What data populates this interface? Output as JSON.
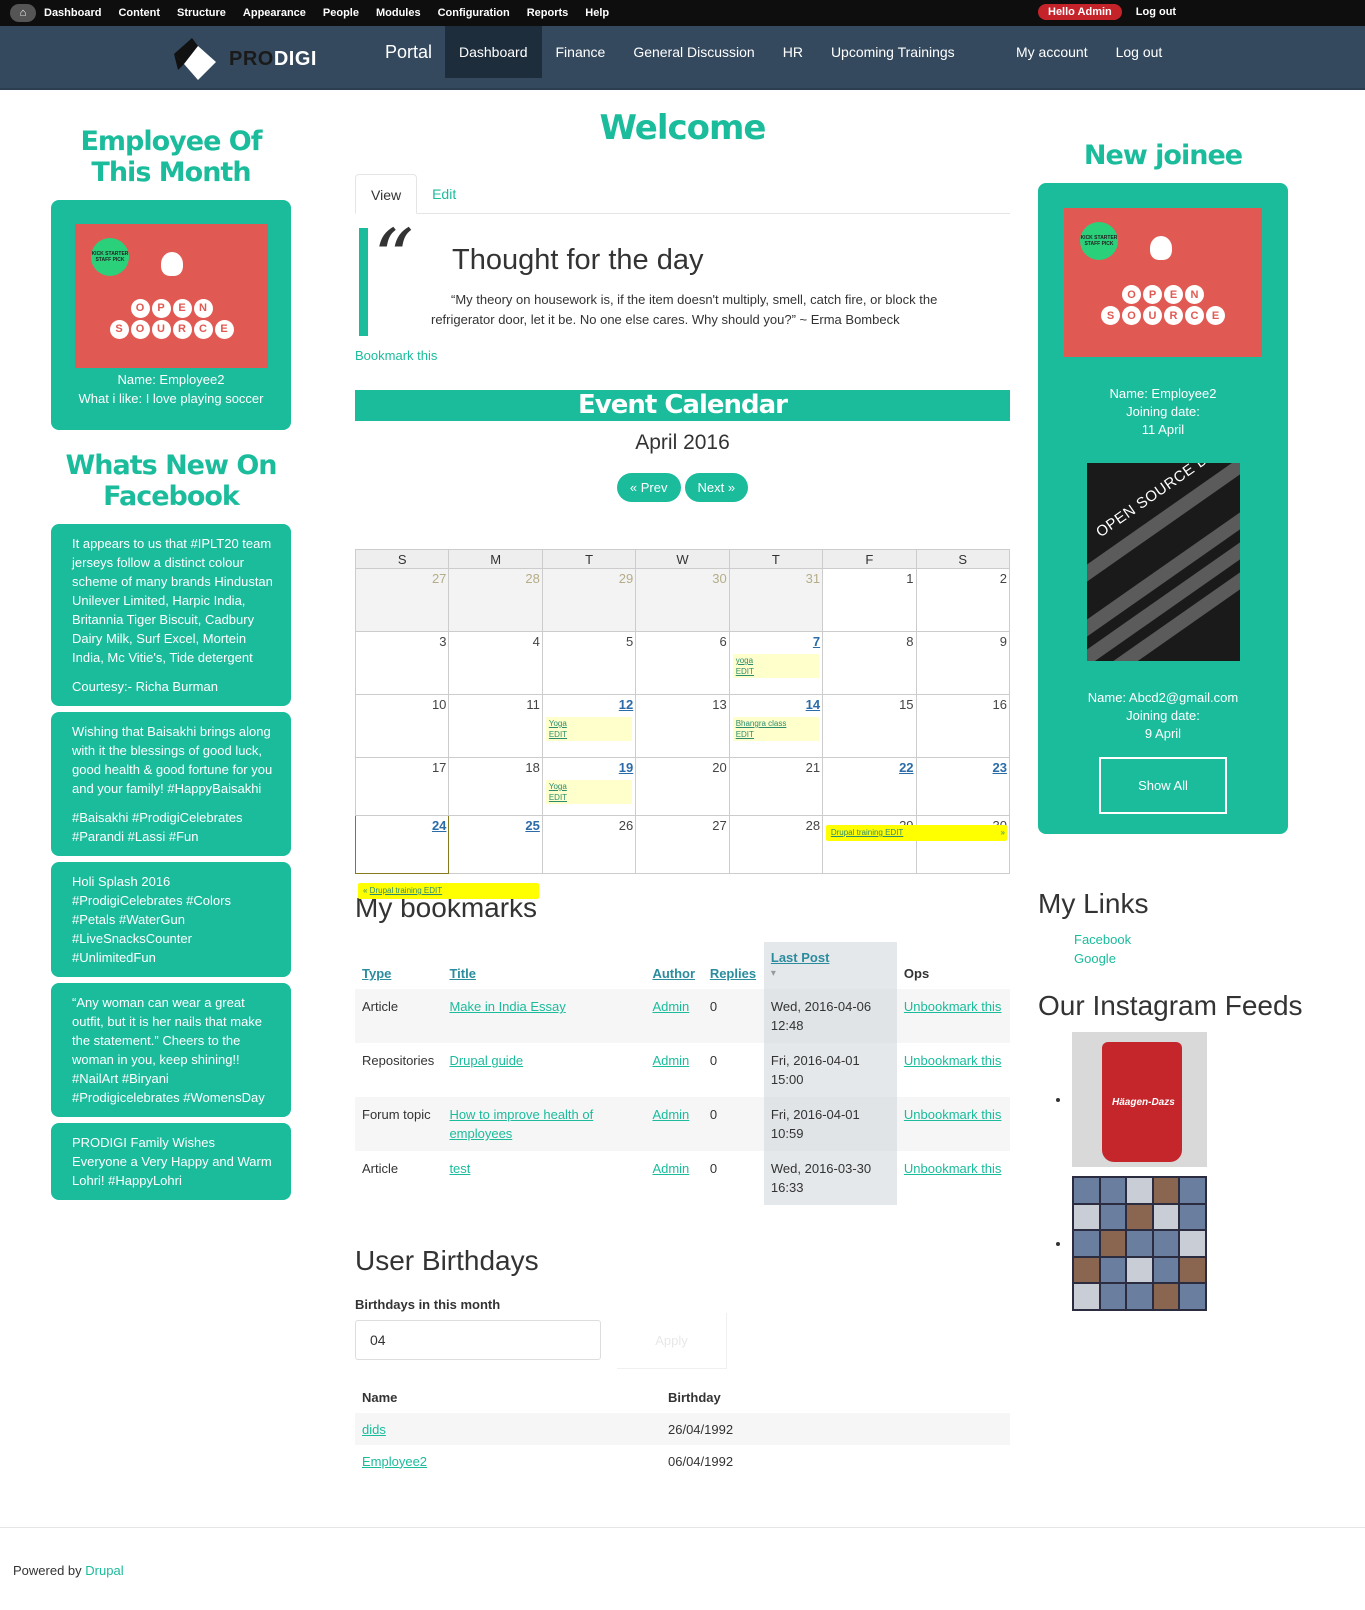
{
  "admin_bar": {
    "items": [
      "Dashboard",
      "Content",
      "Structure",
      "Appearance",
      "People",
      "Modules",
      "Configuration",
      "Reports",
      "Help"
    ],
    "hello": "Hello Admin",
    "logout": "Log out"
  },
  "navbar": {
    "logo_pro": "PRO",
    "logo_digi": "DIGI",
    "title": "Portal",
    "links": [
      "Dashboard",
      "Finance",
      "General Discussion",
      "HR",
      "Upcoming Trainings"
    ],
    "active": "Dashboard",
    "right_links": [
      "My account",
      "Log out"
    ]
  },
  "employee_month": {
    "title": "Employee Of This Month",
    "badge": "KICK STARTER STAFF PICK",
    "image_letters_top": [
      "O",
      "P",
      "E",
      "N"
    ],
    "image_letters_bottom": [
      "S",
      "O",
      "U",
      "R",
      "C",
      "E"
    ],
    "name": "Name: Employee2",
    "like": "What i like: I love playing soccer"
  },
  "facebook": {
    "title": "Whats New On Facebook",
    "posts": [
      [
        "It appears to us that #IPLT20 team jerseys follow a distinct colour scheme of many brands Hindustan Unilever Limited, Harpic India, Britannia Tiger Biscuit, Cadbury Dairy Milk, Surf Excel, Mortein India, Mc Vitie's, Tide detergent",
        "Courtesy:- Richa Burman"
      ],
      [
        "Wishing that Baisakhi brings along with it the blessings of good luck, good health & good fortune for you and your family! #HappyBaisakhi",
        "#Baisakhi #ProdigiCelebrates #Parandi #Lassi #Fun"
      ],
      [
        "Holi Splash 2016 #ProdigiCelebrates #Colors #Petals #WaterGun #LiveSnacksCounter #UnlimitedFun"
      ],
      [
        "“Any woman can wear a great outfit, but it is her nails that make the statement.” Cheers to the woman in you, keep shining!! #NailArt #Biryani #Prodigicelebrates #WomensDay"
      ],
      [
        "PRODIGI Family Wishes Everyone a Very Happy and Warm Lohri! #HappyLohri"
      ]
    ]
  },
  "center": {
    "welcome": "Welcome",
    "tabs": [
      "View",
      "Edit"
    ],
    "quote_mark": "“",
    "quote_title": "Thought for the day",
    "quote_text_1": "“My theory on housework is, if the item doesn't multiply, smell, catch fire, or block the",
    "quote_text_2": "refrigerator door, let it be. No one else cares. Why should you?” ~ Erma Bombeck",
    "bookmark_this": "Bookmark this"
  },
  "calendar": {
    "title": "Event Calendar",
    "month": "April 2016",
    "prev": "« Prev",
    "next": "Next »",
    "days": [
      "S",
      "M",
      "T",
      "W",
      "T",
      "F",
      "S"
    ],
    "weeks": [
      [
        {
          "d": "27",
          "o": true
        },
        {
          "d": "28",
          "o": true
        },
        {
          "d": "29",
          "o": true
        },
        {
          "d": "30",
          "o": true
        },
        {
          "d": "31",
          "o": true
        },
        {
          "d": "1"
        },
        {
          "d": "2"
        }
      ],
      [
        {
          "d": "3"
        },
        {
          "d": "4"
        },
        {
          "d": "5"
        },
        {
          "d": "6"
        },
        {
          "d": "7",
          "link": true,
          "ev": "yoga"
        },
        {
          "d": "8"
        },
        {
          "d": "9"
        }
      ],
      [
        {
          "d": "10"
        },
        {
          "d": "11"
        },
        {
          "d": "12",
          "link": true,
          "ev": "Yoga"
        },
        {
          "d": "13"
        },
        {
          "d": "14",
          "link": true,
          "ev": "Bhangra class"
        },
        {
          "d": "15"
        },
        {
          "d": "16"
        }
      ],
      [
        {
          "d": "17"
        },
        {
          "d": "18"
        },
        {
          "d": "19",
          "link": true,
          "ev": "Yoga"
        },
        {
          "d": "20"
        },
        {
          "d": "21"
        },
        {
          "d": "22",
          "link": true
        },
        {
          "d": "23",
          "link": true
        }
      ],
      [
        {
          "d": "24",
          "link": true,
          "today": true
        },
        {
          "d": "25",
          "link": true
        },
        {
          "d": "26"
        },
        {
          "d": "27"
        },
        {
          "d": "28"
        },
        {
          "d": "29"
        },
        {
          "d": "30"
        }
      ]
    ],
    "edit_label": "EDIT",
    "span_event_1": "Drupal training EDIT",
    "span_event_2": "Drupal training EDIT",
    "span_arrow_right": "»",
    "span_arrow_left": "«"
  },
  "bookmarks": {
    "title": "My bookmarks",
    "headers": [
      "Type",
      "Title",
      "Author",
      "Replies",
      "Last Post",
      "Ops"
    ],
    "rows": [
      [
        "Article",
        "Make in India Essay",
        "Admin",
        "0",
        "Wed, 2016-04-06 12:48",
        "Unbookmark this"
      ],
      [
        "Repositories",
        "Drupal guide",
        "Admin",
        "0",
        "Fri, 2016-04-01 15:00",
        "Unbookmark this"
      ],
      [
        "Forum topic",
        "How to improve health of employees",
        "Admin",
        "0",
        "Fri, 2016-04-01 10:59",
        "Unbookmark this"
      ],
      [
        "Article",
        "test",
        "Admin",
        "0",
        "Wed, 2016-03-30 16:33",
        "Unbookmark this"
      ]
    ]
  },
  "birthdays": {
    "title": "User Birthdays",
    "label": "Birthdays in this month",
    "value": "04",
    "apply": "Apply",
    "headers": [
      "Name",
      "Birthday"
    ],
    "rows": [
      [
        "dids",
        "26/04/1992"
      ],
      [
        "Employee2",
        "06/04/1992"
      ]
    ]
  },
  "new_joinee": {
    "title": "New joinee",
    "badge": "KICK STARTER STAFF PICK",
    "person1": [
      "Name: Employee2",
      "Joining date:",
      "11 April"
    ],
    "poster_text": "OPEN SOURCE DAY",
    "person2": [
      "Name: Abcd2@gmail.com",
      "Joining date:",
      "9 April"
    ],
    "show_all": "Show All"
  },
  "my_links": {
    "title": "My Links",
    "links": [
      "Facebook",
      "Google"
    ]
  },
  "instagram": {
    "title": "Our Instagram Feeds",
    "cup_text": "Häagen-Dazs"
  },
  "footer": {
    "powered": "Powered by",
    "drupal": "Drupal"
  },
  "colors": {
    "accent": "#1abc9c",
    "navbar": "#34495e",
    "admin_bar": "#0e0e0e",
    "hello_badge": "#c4232a"
  }
}
